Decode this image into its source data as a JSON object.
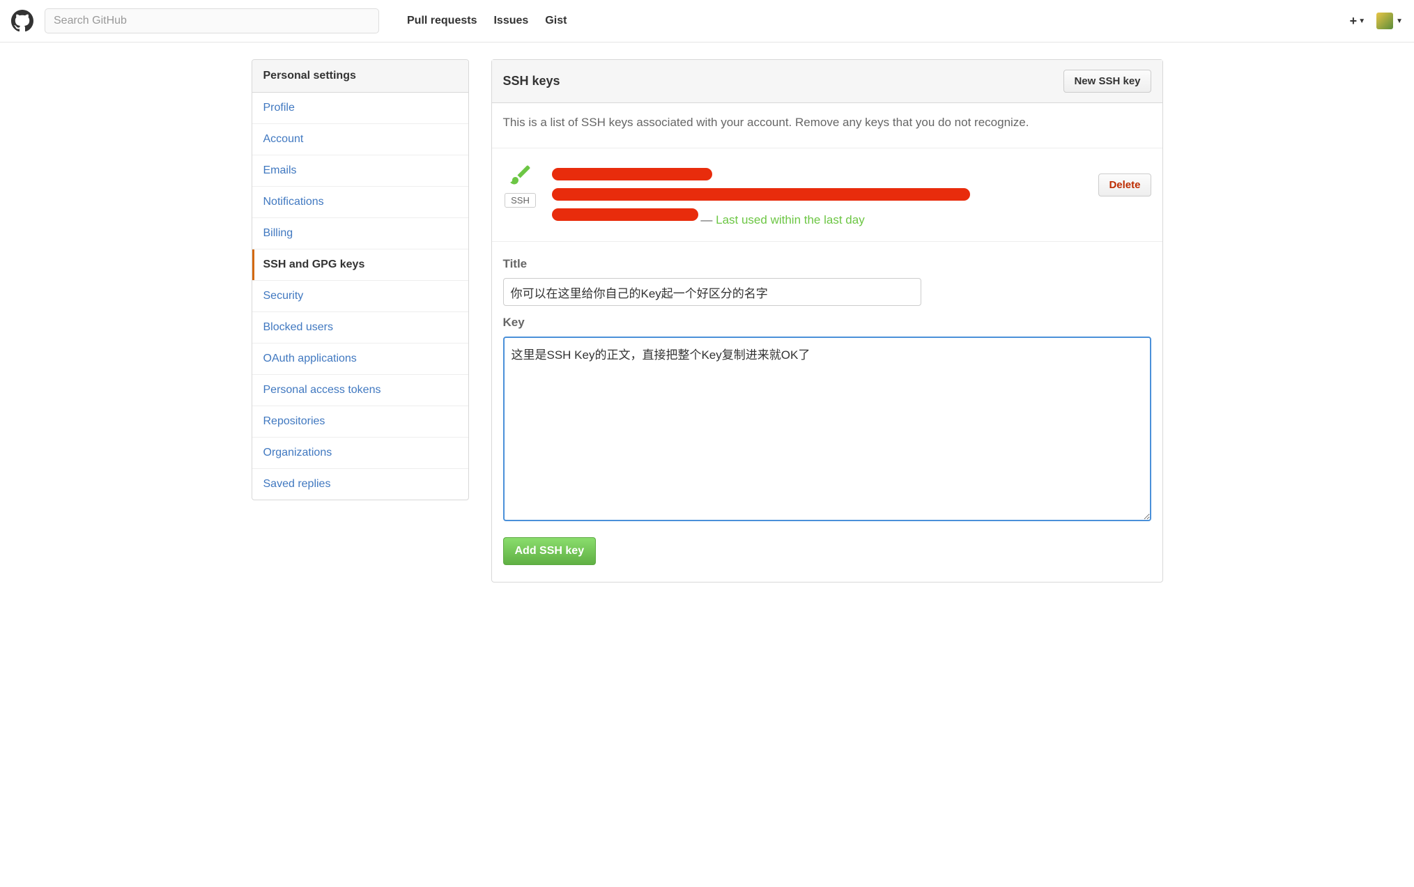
{
  "header": {
    "search_placeholder": "Search GitHub",
    "nav": {
      "pull_requests": "Pull requests",
      "issues": "Issues",
      "gist": "Gist"
    }
  },
  "sidebar": {
    "title": "Personal settings",
    "items": [
      {
        "label": "Profile"
      },
      {
        "label": "Account"
      },
      {
        "label": "Emails"
      },
      {
        "label": "Notifications"
      },
      {
        "label": "Billing"
      },
      {
        "label": "SSH and GPG keys"
      },
      {
        "label": "Security"
      },
      {
        "label": "Blocked users"
      },
      {
        "label": "OAuth applications"
      },
      {
        "label": "Personal access tokens"
      },
      {
        "label": "Repositories"
      },
      {
        "label": "Organizations"
      },
      {
        "label": "Saved replies"
      }
    ]
  },
  "panel": {
    "title": "SSH keys",
    "new_key_button": "New SSH key",
    "description": "This is a list of SSH keys associated with your account. Remove any keys that you do not recognize.",
    "key_entry": {
      "badge": "SSH",
      "last_used_prefix": "— ",
      "last_used": "Last used within the last day",
      "delete_button": "Delete"
    },
    "form": {
      "title_label": "Title",
      "title_value": "你可以在这里给你自己的Key起一个好区分的名字",
      "key_label": "Key",
      "key_value": "这里是SSH Key的正文，直接把整个Key复制进来就OK了",
      "submit_button": "Add SSH key"
    }
  }
}
